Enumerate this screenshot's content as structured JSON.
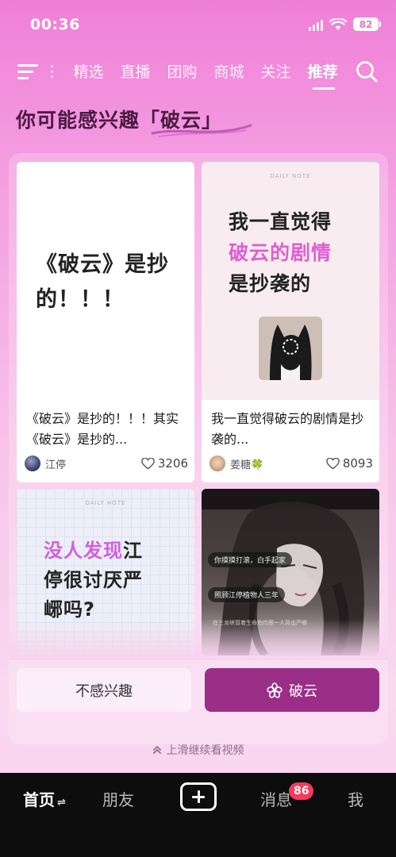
{
  "status_bar": {
    "time": "00:36",
    "battery": "82",
    "icons": [
      "signal-icon",
      "wifi-icon",
      "battery-icon"
    ]
  },
  "top_nav": {
    "tabs": [
      {
        "label": "精选",
        "active": false
      },
      {
        "label": "直播",
        "active": false
      },
      {
        "label": "团购",
        "active": false
      },
      {
        "label": "商城",
        "active": false
      },
      {
        "label": "关注",
        "active": false
      },
      {
        "label": "推荐",
        "active": true
      }
    ],
    "icons": [
      "menu-icon",
      "search-icon"
    ]
  },
  "headline": {
    "prefix": "你可能感兴趣",
    "topic": "「破云」"
  },
  "cards": [
    {
      "cover_text": "《破云》是抄的！！！",
      "title": "《破云》是抄的！！！其实《破云》是抄的...",
      "author": "江停",
      "likes": "3206"
    },
    {
      "cover_note": "DAILY NOTE",
      "cover_lines": [
        "我一直觉得",
        "破云的剧情",
        "是抄袭的"
      ],
      "title": "我一直觉得破云的剧情是抄袭的...",
      "author": "姜糖🍀",
      "likes": "8093"
    },
    {
      "cover_note": "DAILY NOTE",
      "cover_highlight": "没人发现",
      "cover_line1_rest": "江",
      "cover_line2": "停很讨厌严",
      "cover_line3": "峫吗?"
    },
    {
      "bubbles": [
        "你摸摸打滚，白手起家",
        "照顾江停植物人三年"
      ],
      "caption": "在三龙峡冒着生命危险跟一人背出严峫"
    }
  ],
  "actions": {
    "not_interested": "不感兴趣",
    "topic_button": "破云"
  },
  "swipe_hint": "上滑继续看视频",
  "bottom_bar": {
    "home": "首页",
    "friends": "朋友",
    "messages": "消息",
    "messages_badge": "86",
    "me": "我"
  },
  "colors": {
    "accent": "#9b2e87",
    "badge": "#f53b5c",
    "highlight_pink": "#df5fcf"
  }
}
